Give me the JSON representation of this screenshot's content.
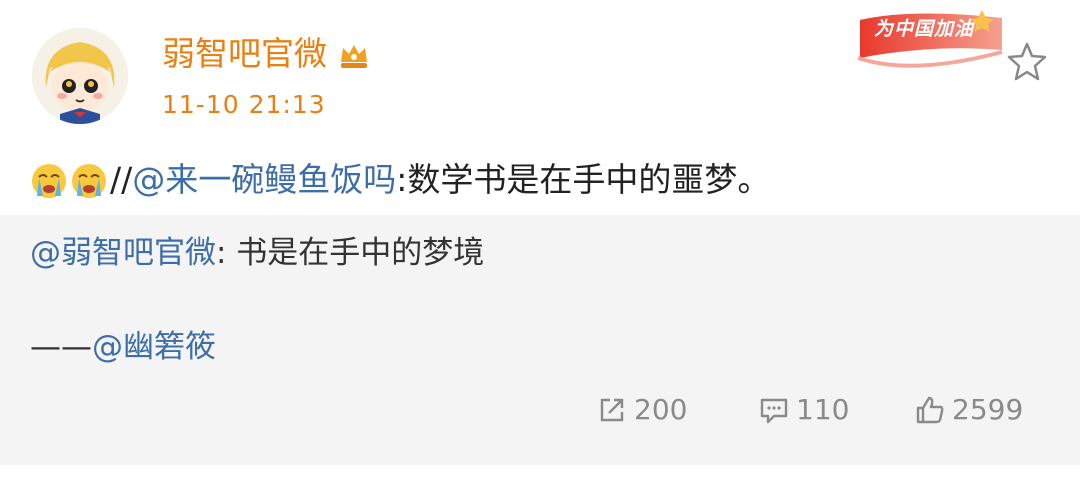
{
  "post": {
    "username": "弱智吧官微",
    "timestamp": "11-10 21:13",
    "badge_text": "为中国加油",
    "text_prefix": "//",
    "mention": "@来一碗鳗鱼饭吗",
    "text_body": ":数学书是在手中的噩梦。",
    "emojis": [
      "crying-emoji",
      "crying-emoji"
    ]
  },
  "repost": {
    "author": "@弱智吧官微",
    "text": ": 书是在手中的梦境",
    "credit_dash": "——",
    "credit_mention": "@幽箬筱"
  },
  "actions": {
    "reposts": "200",
    "comments": "110",
    "likes": "2599"
  },
  "colors": {
    "username": "#ea8011",
    "mention": "#3e6ea7",
    "repost_bg": "#f4f4f4",
    "action": "#8a8a8a"
  }
}
